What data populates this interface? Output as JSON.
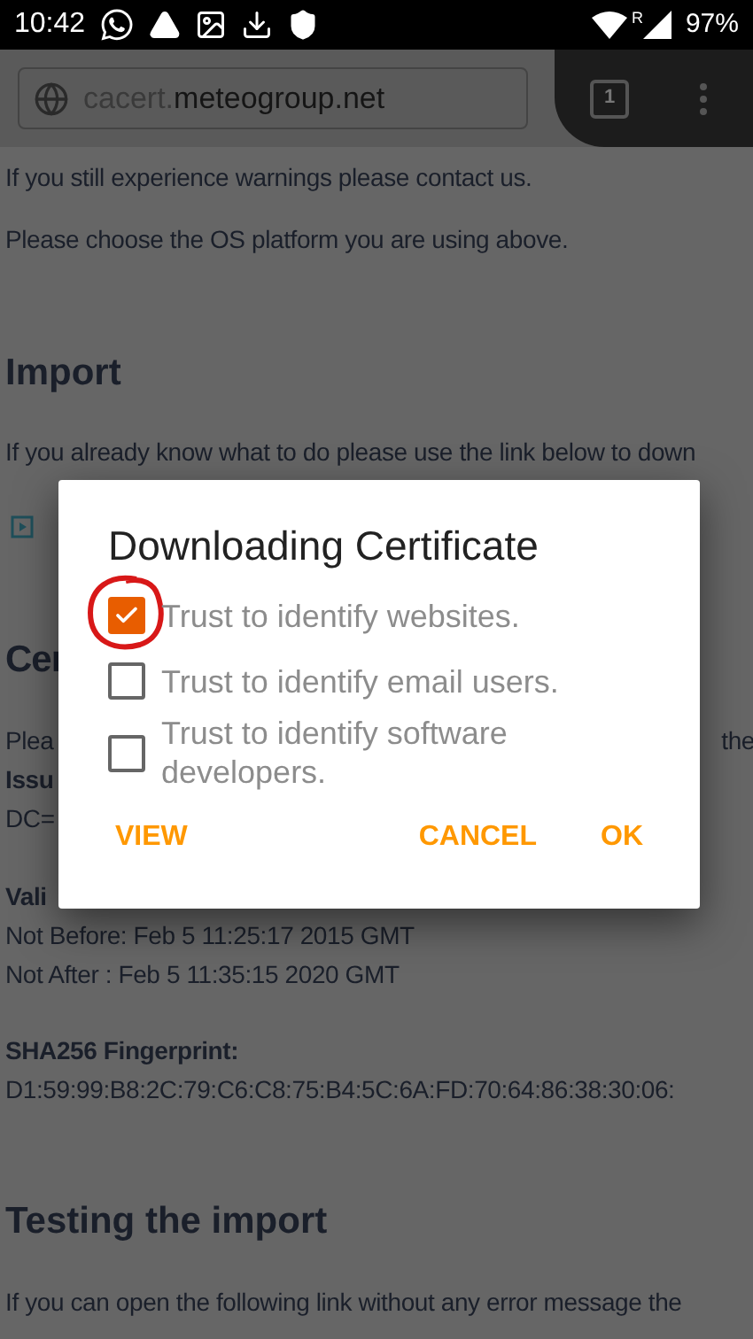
{
  "status_bar": {
    "time": "10:42",
    "roaming": "R",
    "battery": "97%"
  },
  "browser": {
    "url_prefix": "cacert.",
    "url_domain": "meteogroup.net",
    "tab_count": "1"
  },
  "page": {
    "intro": "If you still experience warnings please contact us.",
    "choose": "Please choose the OS platform you are using above.",
    "import_heading": "Import",
    "import_text": "If you already know what to do please use the link below to down",
    "cert_heading_fragment": "Cer",
    "please_fragment": "Plea",
    "please_right_fragment": "the",
    "issuer_fragment": "Issu",
    "dc_fragment": "DC=",
    "validity_fragment": "Vali",
    "not_before": "Not Before: Feb 5 11:25:17 2015 GMT",
    "not_after": "Not After : Feb 5 11:35:15 2020 GMT",
    "fingerprint_label": "SHA256 Fingerprint:",
    "fingerprint": "D1:59:99:B8:2C:79:C6:C8:75:B4:5C:6A:FD:70:64:86:38:30:06:",
    "testing_heading": "Testing the import",
    "testing_text": "If you can open the following link without any error message the"
  },
  "dialog": {
    "title": "Downloading Certificate",
    "options": [
      {
        "label": "Trust to identify websites.",
        "checked": true
      },
      {
        "label": "Trust to identify email users.",
        "checked": false
      },
      {
        "label": "Trust to identify software developers.",
        "checked": false
      }
    ],
    "buttons": [
      "VIEW",
      "CANCEL",
      "OK"
    ]
  }
}
